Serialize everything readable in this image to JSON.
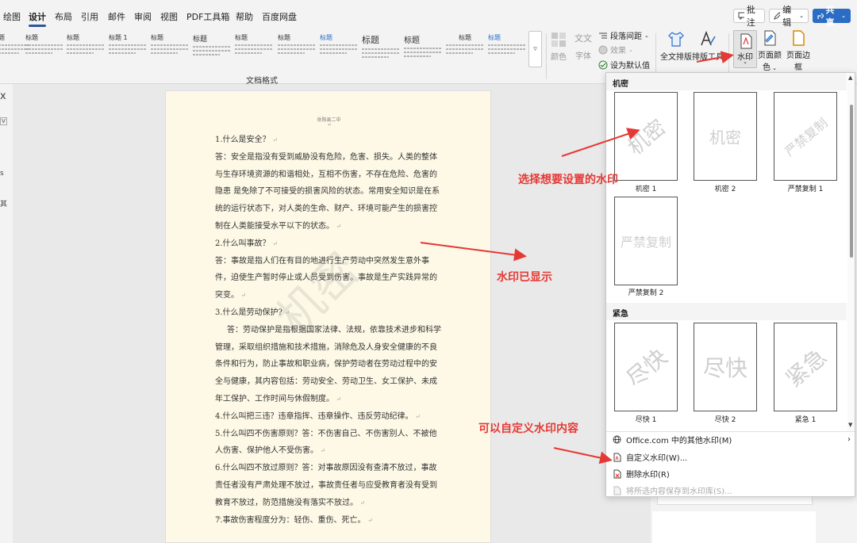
{
  "menu": {
    "items": [
      "绘图",
      "设计",
      "布局",
      "引用",
      "邮件",
      "审阅",
      "视图",
      "PDF工具箱",
      "帮助",
      "百度网盘"
    ],
    "active_index": 1
  },
  "top_buttons": {
    "comment": "批注",
    "edit": "编辑",
    "share": "共享"
  },
  "ribbon": {
    "style_titles": [
      "标题",
      "标题",
      "标题",
      "标题 1",
      "标题",
      "标题",
      "标题",
      "标题",
      "标题",
      "标题",
      "标题",
      "标题",
      "标题"
    ],
    "group_label": "文档格式",
    "color": "颜色",
    "font": "字体",
    "font_preview": "文文",
    "paragraph_spacing": "段落间距",
    "effects": "效果",
    "set_default": "设为默认值",
    "full_layout": "全文排版",
    "layout_tools": "排版工具",
    "watermark": "水印",
    "page_color_line1": "页面颜",
    "page_color_line2": "色",
    "page_border": "页面边框"
  },
  "left_strip_glyphs": [
    "x",
    "ᐯ",
    "s",
    "其"
  ],
  "document": {
    "header": "岳阳县二中",
    "paragraphs": [
      {
        "text": "1.什么是安全？",
        "indent": false
      },
      {
        "text": "答：安全是指没有受到威胁没有危险，危害、损失。人类的整体与生存环境资源的和谐相处，互相不伤害，不存在危险、危害的隐患 是免除了不可接受的损害风险的状态。常用安全知识是在系统的运行状态下，对人类的生命、财产、环境可能产生的损害控制在人类能接受水平以下的状态。",
        "indent": false
      },
      {
        "text": "2.什么叫事故？",
        "indent": false
      },
      {
        "text": "答：事故是指人们在有目的地进行生产劳动中突然发生意外事件，迫使生产暂时停止或人员受到伤害。事故是生产实践异常的突变。",
        "indent": false
      },
      {
        "text": "3.什么是劳动保护?",
        "indent": false
      },
      {
        "text": "答：劳动保护是指根据国家法律、法规，依靠技术进步和科学管理，采取组织措施和技术措施，消除危及人身安全健康的不良条件和行为，防止事故和职业病，保护劳动者在劳动过程中的安全与健康，其内容包括：劳动安全、劳动卫生、女工保护、未成年工保护、工作时间与休假制度。",
        "indent": true
      },
      {
        "text": "4.什么叫把三违？违章指挥、违章操作、违反劳动纪律。",
        "indent": false
      },
      {
        "text": "5.什么叫四不伤害原则？答：不伤害自己、不伤害别人、不被他人伤害、保护他人不受伤害。",
        "indent": false
      },
      {
        "text": "6.什么叫四不放过原则？答：对事故原因没有查清不放过，事故责任者没有严肃处理不放过，事故责任者与应受教育者没有受到教育不放过，防范措施没有落实不放过。",
        "indent": false
      },
      {
        "text": "7.事故伤害程度分为：轻伤、重伤、死亡。",
        "indent": false
      }
    ],
    "watermark_text": "机密"
  },
  "dropdown": {
    "section1": "机密",
    "section2": "紧急",
    "tiles_row1": [
      {
        "text": "机密",
        "label": "机密 1",
        "diagonal": true
      },
      {
        "text": "机密",
        "label": "机密 2",
        "diagonal": false
      },
      {
        "text": "严禁复制",
        "label": "严禁复制 1",
        "diagonal": true
      }
    ],
    "tiles_row2": [
      {
        "text": "严禁复制",
        "label": "严禁复制 2",
        "diagonal": false
      }
    ],
    "tiles_row3": [
      {
        "text": "尽快",
        "label": "尽快 1",
        "diagonal": true
      },
      {
        "text": "尽快",
        "label": "尽快 2",
        "diagonal": false
      },
      {
        "text": "紧急",
        "label": "紧急 1",
        "diagonal": true
      }
    ],
    "menu": {
      "more_office": "Office.com 中的其他水印(M)",
      "custom": "自定义水印(W)...",
      "remove": "删除水印(R)",
      "save_selection": "将所选内容保存到水印库(S)..."
    }
  },
  "annotations": {
    "choose": "选择想要设置的水印",
    "shown": "水印已显示",
    "custom": "可以自定义水印内容"
  },
  "colors": {
    "accent": "#2b579a",
    "share": "#2b6cc4",
    "annotation": "#e53935",
    "page": "#fdf9e6"
  }
}
